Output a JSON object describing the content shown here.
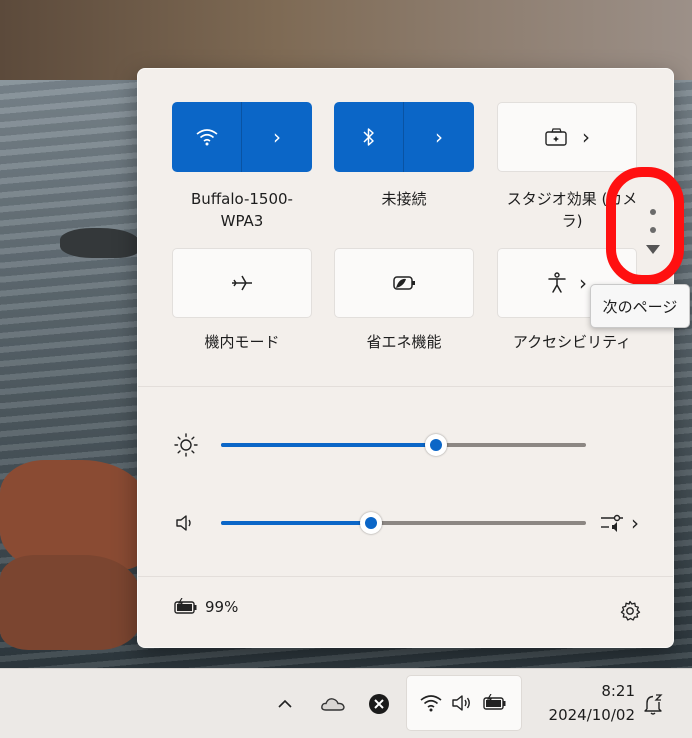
{
  "quick_settings": {
    "tiles_row1": [
      {
        "label": "Buffalo-1500-\nWPA3",
        "icon": "wifi-icon",
        "state": "on",
        "label_line1": "Buffalo-1500-",
        "label_line2": "WPA3"
      },
      {
        "label": "未接続",
        "icon": "bluetooth-icon",
        "state": "on"
      },
      {
        "label_line1": "スタジオ効果 (カメ",
        "label_line2": "ラ)",
        "icon": "studio-effects-icon",
        "state": "off"
      }
    ],
    "tiles_row2": [
      {
        "label": "機内モード",
        "icon": "airplane-icon",
        "state": "off"
      },
      {
        "label": "省エネ機能",
        "icon": "energy-saver-icon",
        "state": "off"
      },
      {
        "label": "アクセシビリティ",
        "icon": "accessibility-icon",
        "state": "off"
      }
    ],
    "brightness": {
      "icon": "brightness-icon",
      "value_percent": 59
    },
    "volume": {
      "icon": "speaker-icon",
      "value_percent": 41
    },
    "battery": {
      "icon": "battery-charging-icon",
      "text": "99%"
    },
    "tooltip": "次のページ",
    "accent_color": "#0b66c7",
    "highlight_color": "#ff1010"
  },
  "taskbar": {
    "time": "8:21",
    "date": "2024/10/02",
    "tray_icons": [
      "chevron-up-icon",
      "onedrive-icon",
      "close-circle-icon",
      "wifi-icon",
      "speaker-icon",
      "battery-charging-icon",
      "notification-snooze-icon"
    ]
  }
}
